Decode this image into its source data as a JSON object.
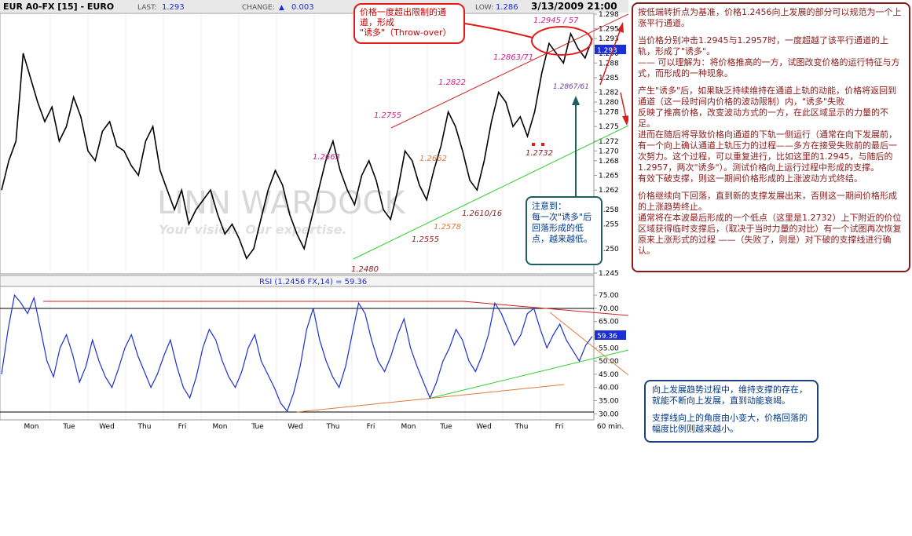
{
  "header": {
    "symbol": "EUR A0-FX [15] - EURO",
    "last_label": "LAST:",
    "last_value": "1.293",
    "change_label": "CHANGE:",
    "change_value": "0.003",
    "low_label": "LOW:",
    "low_value": "1.286",
    "datetime": "3/13/2009 21:00"
  },
  "watermark": {
    "brand": "LINN WARDOCK",
    "tagline": "Your vision. Our expertise."
  },
  "price_labels": [
    {
      "text": "1.2945 / 57",
      "color": "#d01c8b"
    },
    {
      "text": "1.2863/71",
      "color": "#d01c8b"
    },
    {
      "text": "1.2822",
      "color": "#d01c8b"
    },
    {
      "text": "1.2755",
      "color": "#d01c8b"
    },
    {
      "text": "1.2663",
      "color": "#d01c8b"
    },
    {
      "text": "1.2662",
      "color": "#e07a3a"
    },
    {
      "text": "1.2578",
      "color": "#e07a3a"
    },
    {
      "text": "1.2555",
      "color": "#8b1a1a"
    },
    {
      "text": "1.2480",
      "color": "#8b1a1a"
    },
    {
      "text": "1.2610/16",
      "color": "#8b1a1a"
    },
    {
      "text": "1.2732",
      "color": "#8b1a1a"
    },
    {
      "text": "1.2867/61",
      "color": "#6a3fa0"
    }
  ],
  "rsi_title": "RSI (1.2456 FX,14) = 59.36",
  "rsi_current": "59.36",
  "price_current": "1.293",
  "callouts": {
    "throw_over": "价格一度超出限制的通道，形成\n\"诱多\"（Throw-over）",
    "note": "注意到：\n每一次\"诱多\"后回落形成的低点，越来越低。",
    "bottom": [
      "向上发展趋势过程中，维持支撑的存在，就能不断向上发展，直到动能衰竭。",
      "支撑线向上的角度由小变大，价格回落的幅度比例则越来越小。"
    ]
  },
  "right_text": [
    "按低端转折点为基准，价格1.2456向上发展的部分可以规范为一个上涨平行通道。",
    "当价格分别冲击1.2945与1.2957时，一度超越了该平行通道的上轨，形成了\"诱多\"。\n—— 可以理解为：将价格推高的一方，试图改变价格的运行特征与方式，而形成的一种现象。",
    "产生\"诱多\"后，如果缺乏持续维持在通道上轨的动能，价格将返回到通道（这一段时间内价格的波动限制）内，\"诱多\"失败\n反映了推高价格，改变波动方式的一方，在此区域显示的力量的不足。\n进而在随后将导致价格向通道的下轨一侧运行（通常在向下发展前，有一个向上确认通道上轨压力的过程——多方在接受失败前的最后一次努力。这个过程，可以重复进行，比如这里的1.2945，与随后的1.2957，两次\"诱多\"）。测试价格向上运行过程中形成的支撑。\n有效下破支撑，则这一期间价格形成的上涨波动方式终结。",
    "价格继续向下回落，直到新的支撑发展出来，否则这一期间价格形成的上涨趋势终止。\n通常将在本波最后形成的一个低点（这里是1.2732）上下附近的价位区域获得临时支撑后，（取决于当时力量的对比）有一个试图再次恢复原来上涨形式的过程 ——（失败了，则是）对下破的支撑线进行确认。"
  ],
  "chart_data": [
    {
      "type": "line",
      "title": "EUR A0-FX [15] - EURO",
      "x_labels": [
        "Mon",
        "Tue",
        "Wed",
        "Thu",
        "Fri",
        "Mon",
        "Tue",
        "Wed",
        "Thu",
        "Fri",
        "Mon",
        "Tue",
        "Wed",
        "Thu",
        "Fri",
        "60 min."
      ],
      "ylim": [
        1.245,
        1.298
      ],
      "y_ticks": [
        1.245,
        1.25,
        1.255,
        1.258,
        1.262,
        1.265,
        1.268,
        1.27,
        1.272,
        1.275,
        1.278,
        1.28,
        1.282,
        1.285,
        1.288,
        1.29,
        1.293,
        1.295,
        1.298
      ],
      "key_points": [
        {
          "label": "1.2480",
          "value": 1.248
        },
        {
          "label": "1.2555",
          "value": 1.2555
        },
        {
          "label": "1.2578",
          "value": 1.2578
        },
        {
          "label": "1.2610/16",
          "value": 1.2613
        },
        {
          "label": "1.2662",
          "value": 1.2662
        },
        {
          "label": "1.2663",
          "value": 1.2663
        },
        {
          "label": "1.2732",
          "value": 1.2732
        },
        {
          "label": "1.2755",
          "value": 1.2755
        },
        {
          "label": "1.2822",
          "value": 1.2822
        },
        {
          "label": "1.2863/71",
          "value": 1.2867
        },
        {
          "label": "1.2867/61",
          "value": 1.2864
        },
        {
          "label": "1.2945 / 57",
          "value": 1.2951
        }
      ],
      "series": [
        {
          "name": "EUR A0-FX [15] - EURO",
          "color": "#000000",
          "values": [
            1.262,
            1.268,
            1.272,
            1.29,
            1.285,
            1.28,
            1.276,
            1.279,
            1.272,
            1.275,
            1.281,
            1.277,
            1.27,
            1.268,
            1.274,
            1.276,
            1.271,
            1.27,
            1.267,
            1.265,
            1.272,
            1.275,
            1.266,
            1.262,
            1.258,
            1.262,
            1.255,
            1.258,
            1.26,
            1.262,
            1.257,
            1.253,
            1.255,
            1.252,
            1.248,
            1.25,
            1.256,
            1.262,
            1.266,
            1.263,
            1.257,
            1.253,
            1.25,
            1.256,
            1.262,
            1.268,
            1.272,
            1.266,
            1.262,
            1.259,
            1.265,
            1.268,
            1.264,
            1.258,
            1.256,
            1.262,
            1.27,
            1.268,
            1.263,
            1.26,
            1.266,
            1.271,
            1.278,
            1.275,
            1.27,
            1.264,
            1.262,
            1.268,
            1.276,
            1.282,
            1.28,
            1.275,
            1.277,
            1.273,
            1.278,
            1.286,
            1.292,
            1.29,
            1.288,
            1.294,
            1.291,
            1.289,
            1.293
          ]
        }
      ]
    },
    {
      "type": "line",
      "title": "RSI (1.2456 FX,14) = 59.36",
      "ylim": [
        28,
        78
      ],
      "y_ticks": [
        30,
        35,
        40,
        45,
        50,
        55,
        60,
        65,
        70,
        75
      ],
      "series": [
        {
          "name": "RSI",
          "color": "#1c2fd6",
          "values": [
            45,
            62,
            75,
            72,
            68,
            74,
            62,
            50,
            44,
            55,
            60,
            52,
            42,
            48,
            58,
            50,
            44,
            40,
            47,
            55,
            60,
            52,
            46,
            40,
            45,
            52,
            58,
            48,
            40,
            36,
            44,
            55,
            62,
            58,
            50,
            44,
            40,
            46,
            55,
            60,
            50,
            45,
            40,
            34,
            31,
            38,
            48,
            62,
            70,
            58,
            50,
            44,
            40,
            48,
            60,
            72,
            68,
            58,
            50,
            46,
            52,
            60,
            66,
            55,
            48,
            42,
            36,
            42,
            50,
            55,
            62,
            58,
            50,
            46,
            52,
            60,
            72,
            68,
            62,
            56,
            60,
            68,
            70,
            62,
            55,
            60,
            64,
            58,
            54,
            50,
            56,
            59.36
          ]
        }
      ]
    }
  ]
}
